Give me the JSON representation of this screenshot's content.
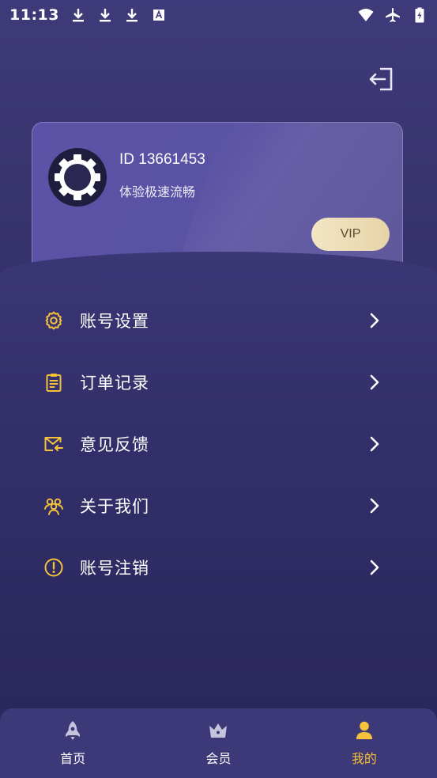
{
  "status_bar": {
    "time": "11:13",
    "left_icons": [
      "download-icon",
      "download-icon",
      "download-icon",
      "text-notification-icon"
    ],
    "right_icons": [
      "wifi-icon",
      "airplane-mode-icon",
      "battery-charging-icon"
    ]
  },
  "header": {
    "logout_icon": "logout-icon"
  },
  "profile": {
    "id_text": "ID 13661453",
    "tagline": "体验极速流畅",
    "vip_label": "VIP",
    "avatar_icon": "gear-icon"
  },
  "menu": {
    "items": [
      {
        "label": "账号设置",
        "icon": "settings-icon"
      },
      {
        "label": "订单记录",
        "icon": "clipboard-icon"
      },
      {
        "label": "意见反馈",
        "icon": "mail-feedback-icon"
      },
      {
        "label": "关于我们",
        "icon": "group-icon"
      },
      {
        "label": "账号注销",
        "icon": "alert-circle-icon"
      }
    ]
  },
  "bottom_nav": {
    "items": [
      {
        "label": "首页",
        "icon": "rocket-icon",
        "active": false
      },
      {
        "label": "会员",
        "icon": "crown-icon",
        "active": false
      },
      {
        "label": "我的",
        "icon": "user-icon",
        "active": true
      }
    ]
  },
  "colors": {
    "accent": "#f5c23a",
    "background_top": "#3f3a79",
    "background_bottom": "#29265a",
    "vip_button": "#f1e1bd"
  }
}
